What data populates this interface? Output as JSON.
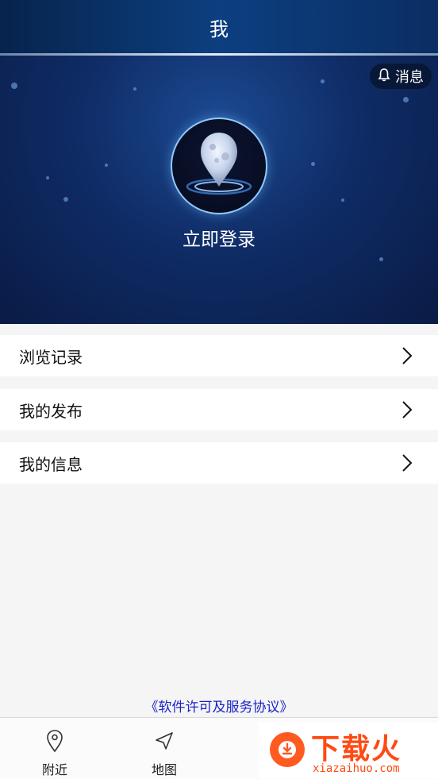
{
  "header": {
    "title": "我"
  },
  "hero": {
    "message_label": "消息",
    "login_label": "立即登录"
  },
  "menu": [
    {
      "label": "浏览记录"
    },
    {
      "label": "我的发布"
    },
    {
      "label": "我的信息"
    }
  ],
  "license_link": "《软件许可及服务协议》",
  "tabbar": {
    "tabs": [
      {
        "label": "附近",
        "icon": "location-pin-icon"
      },
      {
        "label": "地图",
        "icon": "navigation-arrow-icon"
      }
    ]
  },
  "watermark": {
    "main": "下载火",
    "sub": "xiazaihuo.com"
  },
  "colors": {
    "header_bg": "#0c3f80",
    "hero_bg": "#0f2c66",
    "link": "#1a22c9",
    "watermark": "#ff4a12"
  }
}
